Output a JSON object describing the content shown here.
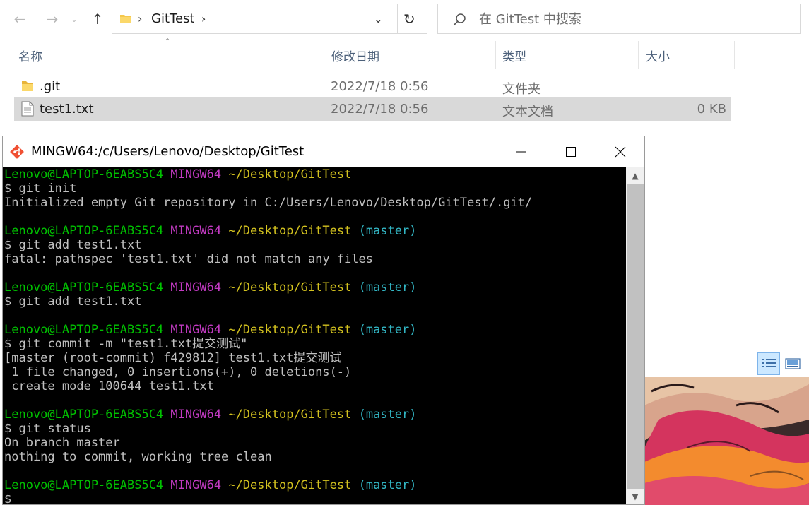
{
  "explorer": {
    "address": {
      "crumb": "GitTest"
    },
    "search": {
      "placeholder": "在 GitTest 中搜索"
    },
    "columns": {
      "name": "名称",
      "date": "修改日期",
      "type": "类型",
      "size": "大小"
    },
    "files": [
      {
        "name": ".git",
        "date": "2022/7/18 0:56",
        "type": "文件夹",
        "size": "",
        "icon": "folder-icon",
        "selected": false
      },
      {
        "name": "test1.txt",
        "date": "2022/7/18 0:56",
        "type": "文本文档",
        "size": "0 KB",
        "icon": "text-file-icon",
        "selected": true
      }
    ]
  },
  "terminal": {
    "title": "MINGW64:/c/Users/Lenovo/Desktop/GitTest",
    "prompt": {
      "user_host": "Lenovo@LAPTOP-6EABS5C4",
      "env": "MINGW64",
      "path": "~/Desktop/GitTest",
      "branch": "(master)"
    },
    "lines": {
      "l1": "$ git init",
      "l2": "Initialized empty Git repository in C:/Users/Lenovo/Desktop/GitTest/.git/",
      "l3": "$ git add test1.txt",
      "l4": "fatal: pathspec 'test1.txt' did not match any files",
      "l5": "$ git add test1.txt",
      "l6": "$ git commit -m \"test1.txt提交测试\"",
      "l7": "[master (root-commit) f429812] test1.txt提交测试",
      "l8": " 1 file changed, 0 insertions(+), 0 deletions(-)",
      "l9": " create mode 100644 test1.txt",
      "l10": "$ git status",
      "l11": "On branch master",
      "l12": "nothing to commit, working tree clean",
      "l13": "$"
    }
  },
  "colors": {
    "prompt_user": "#00c200",
    "prompt_env": "#c23ac2",
    "prompt_path": "#d3c21f",
    "prompt_branch": "#33b8c6",
    "console_bg": "#000000",
    "selection": "#d9d9d9"
  }
}
